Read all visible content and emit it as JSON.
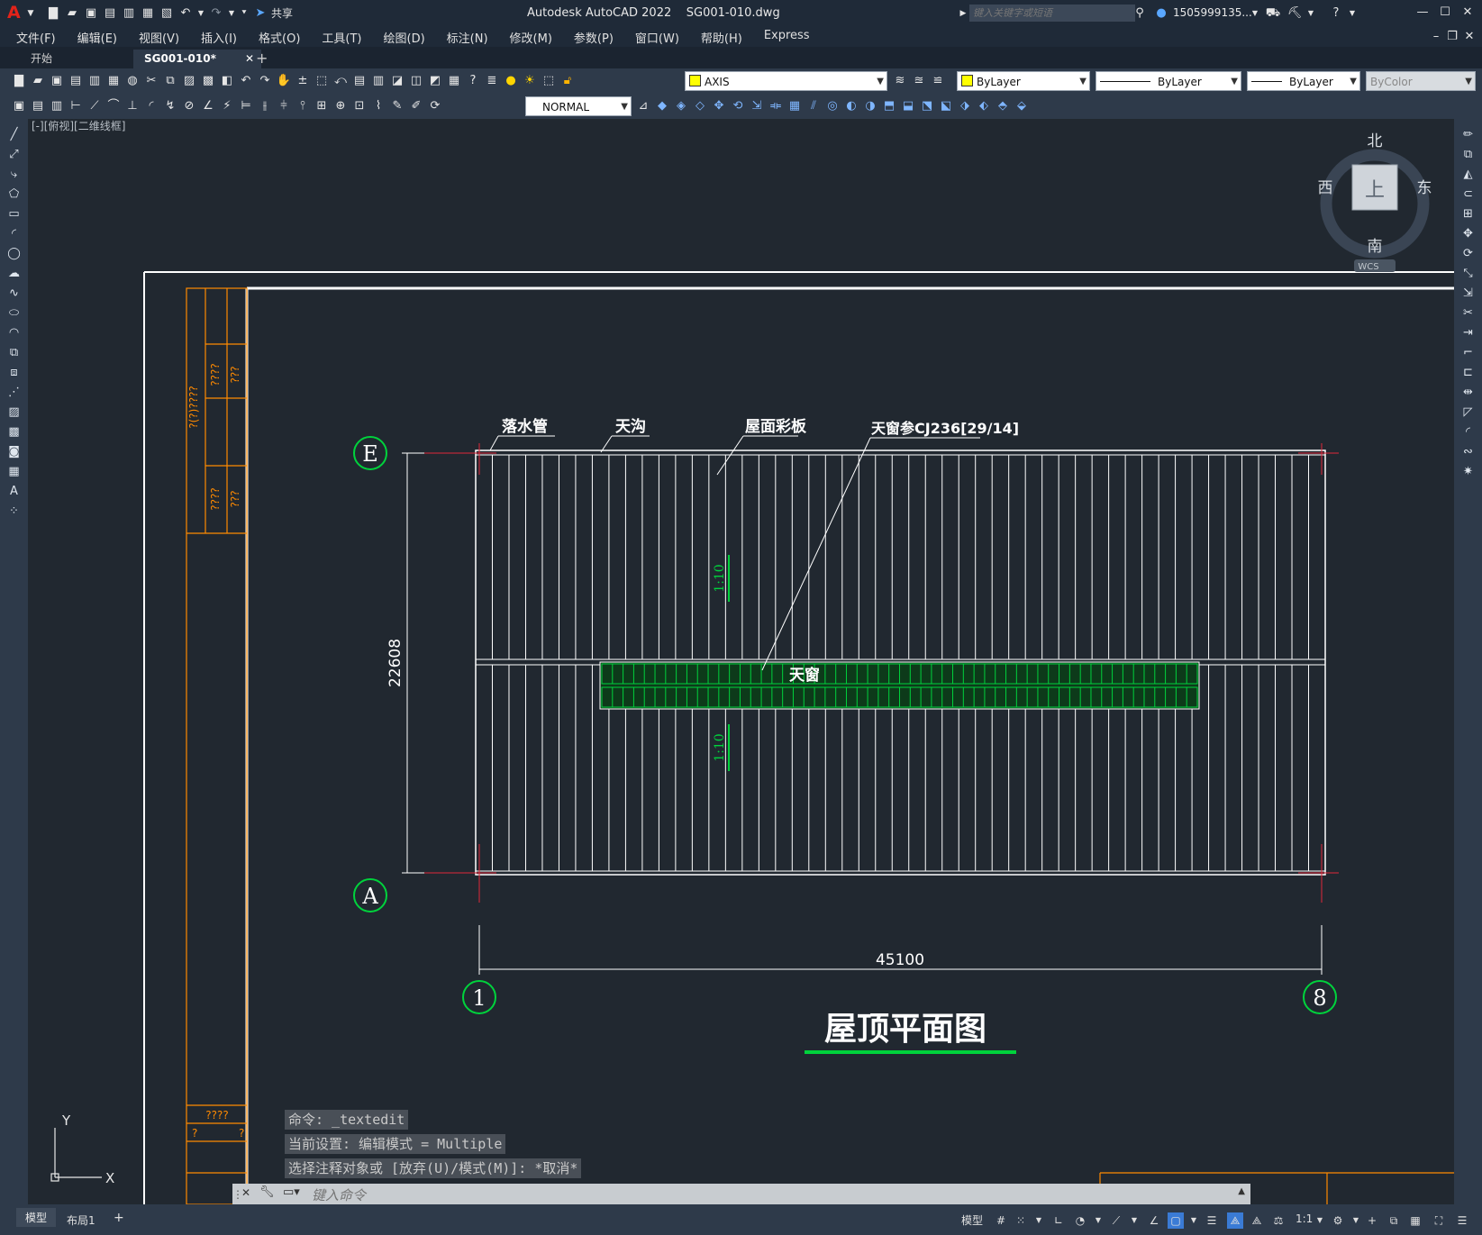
{
  "app": {
    "logo": "A",
    "title": "Autodesk AutoCAD 2022",
    "filename": "SG001-010.dwg",
    "share_label": "共享",
    "search_placeholder": "键入关键字或短语",
    "user": "1505999135...",
    "help_icon": "help-icon"
  },
  "menu": [
    "文件(F)",
    "编辑(E)",
    "视图(V)",
    "插入(I)",
    "格式(O)",
    "工具(T)",
    "绘图(D)",
    "标注(N)",
    "修改(M)",
    "参数(P)",
    "窗口(W)",
    "帮助(H)",
    "Express"
  ],
  "tabs": {
    "start": "开始",
    "active": "SG001-010*",
    "add": "+"
  },
  "toolbar": {
    "layer": "AXIS",
    "color": "ByLayer",
    "linetype": "ByLayer",
    "lineweight": "ByLayer",
    "plotstyle": "ByColor",
    "dimstyle": "NORMAL",
    "layer_swatch": "#ffff00"
  },
  "viewport": {
    "label": "[-][俯视][二维线框]"
  },
  "viewcube": {
    "north": "北",
    "south": "南",
    "east": "东",
    "west": "西",
    "top": "上",
    "wcs": "WCS"
  },
  "drawing": {
    "labels": {
      "downpipe": "落水管",
      "gutter": "天沟",
      "roof_panel": "屋面彩板",
      "skylight_ref": "天窗参CJ236[29/14]",
      "skylight": "天窗"
    },
    "slope": "1:10",
    "dim_height": "22608",
    "dim_width": "45100",
    "axes": {
      "top": "E",
      "bottom": "A",
      "left": "1",
      "right": "8"
    },
    "title": "屋顶平面图",
    "title_block_marks": [
      "????",
      "???",
      "?(?)????",
      "????",
      "???",
      "????",
      "?",
      "?"
    ]
  },
  "ucs": {
    "x": "X",
    "y": "Y"
  },
  "command": {
    "history": [
      "命令: _textedit",
      "当前设置: 编辑模式 = Multiple",
      "选择注释对象或 [放弃(U)/模式(M)]: *取消*"
    ],
    "placeholder": "键入命令"
  },
  "status": {
    "model_tab": "模型",
    "layout_tab": "布局1",
    "add": "+",
    "model": "模型",
    "scale": "1:1"
  }
}
